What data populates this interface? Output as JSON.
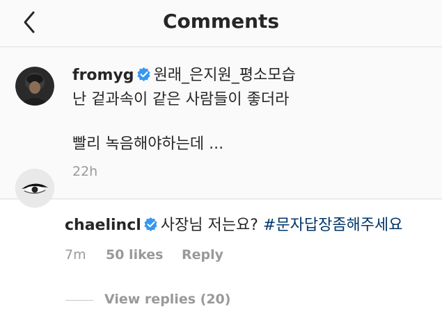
{
  "header": {
    "title": "Comments",
    "back_icon": "chevron-left-icon"
  },
  "caption": {
    "username": "fromyg",
    "headline": "원래_은지원_평소모습",
    "line1": "난 겉과속이 같은 사람들이 좋더라",
    "line2": "빨리 녹음해야하는데 ...",
    "time": "22h"
  },
  "comment": {
    "username": "chaelincl",
    "text": "사장님 저는요?",
    "hashtag": "#문자답장좀해주세요",
    "time": "7m",
    "likes": "50 likes",
    "reply": "Reply",
    "view_replies": "View replies (20)"
  },
  "colors": {
    "verified": "#3897f0",
    "hashtag": "#003569",
    "meta": "#999999"
  }
}
